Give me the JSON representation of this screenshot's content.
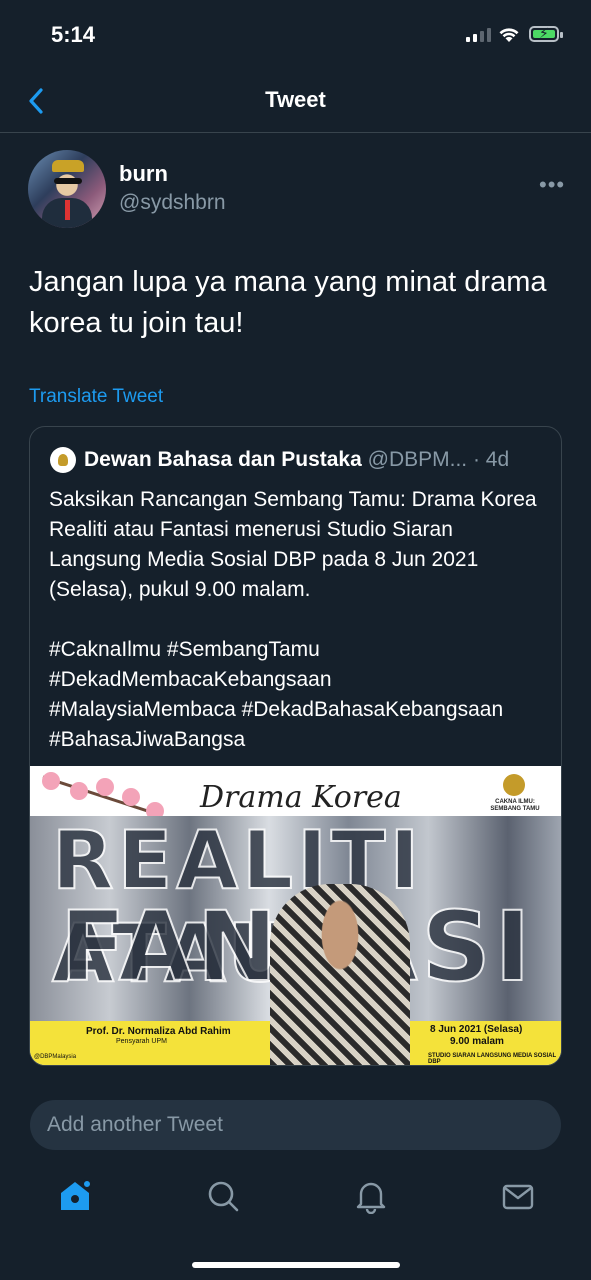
{
  "status_bar": {
    "time": "5:14"
  },
  "nav": {
    "title": "Tweet"
  },
  "tweet": {
    "display_name": "burn",
    "handle": "@sydshbrn",
    "text": "Jangan lupa ya mana yang minat drama korea tu join tau!",
    "translate_label": "Translate Tweet"
  },
  "quoted_tweet": {
    "name": "Dewan Bahasa dan Pustaka",
    "handle": "@DBPM...",
    "time": "· 4d",
    "text": "Saksikan Rancangan Sembang Tamu: Drama Korea Realiti atau Fantasi menerusi Studio Siaran Langsung Media Sosial DBP pada 8 Jun 2021 (Selasa), pukul 9.00 malam.\n\n#CaknaIlmu #SembangTamu\n#DekadMembacaKebangsaan\n#MalaysiaMembaca #DekadBahasaKebangsaan\n#BahasaJiwaBangsa",
    "poster": {
      "subtitle": "Drama Korea",
      "line1": "REALITI ATAU",
      "line2": "FANTASI",
      "logo_text": "CAKNA ILMU: SEMBANG TAMU",
      "speaker": "Prof. Dr. Normaliza Abd Rahim",
      "speaker_role": "Pensyarah UPM",
      "date": "8 Jun 2021 (Selasa)",
      "time": "9.00 malam",
      "studio": "STUDIO SIARAN LANGSUNG MEDIA SOSIAL DBP",
      "socials": "@DBPMalaysia"
    }
  },
  "reply": {
    "placeholder": "Add another Tweet"
  },
  "tab_bar": {
    "icons": [
      "home-icon",
      "search-icon",
      "notifications-icon",
      "messages-icon"
    ]
  },
  "colors": {
    "background": "#15202b",
    "accent": "#1d9bf0",
    "muted": "#8899a6",
    "border": "#38444d"
  }
}
